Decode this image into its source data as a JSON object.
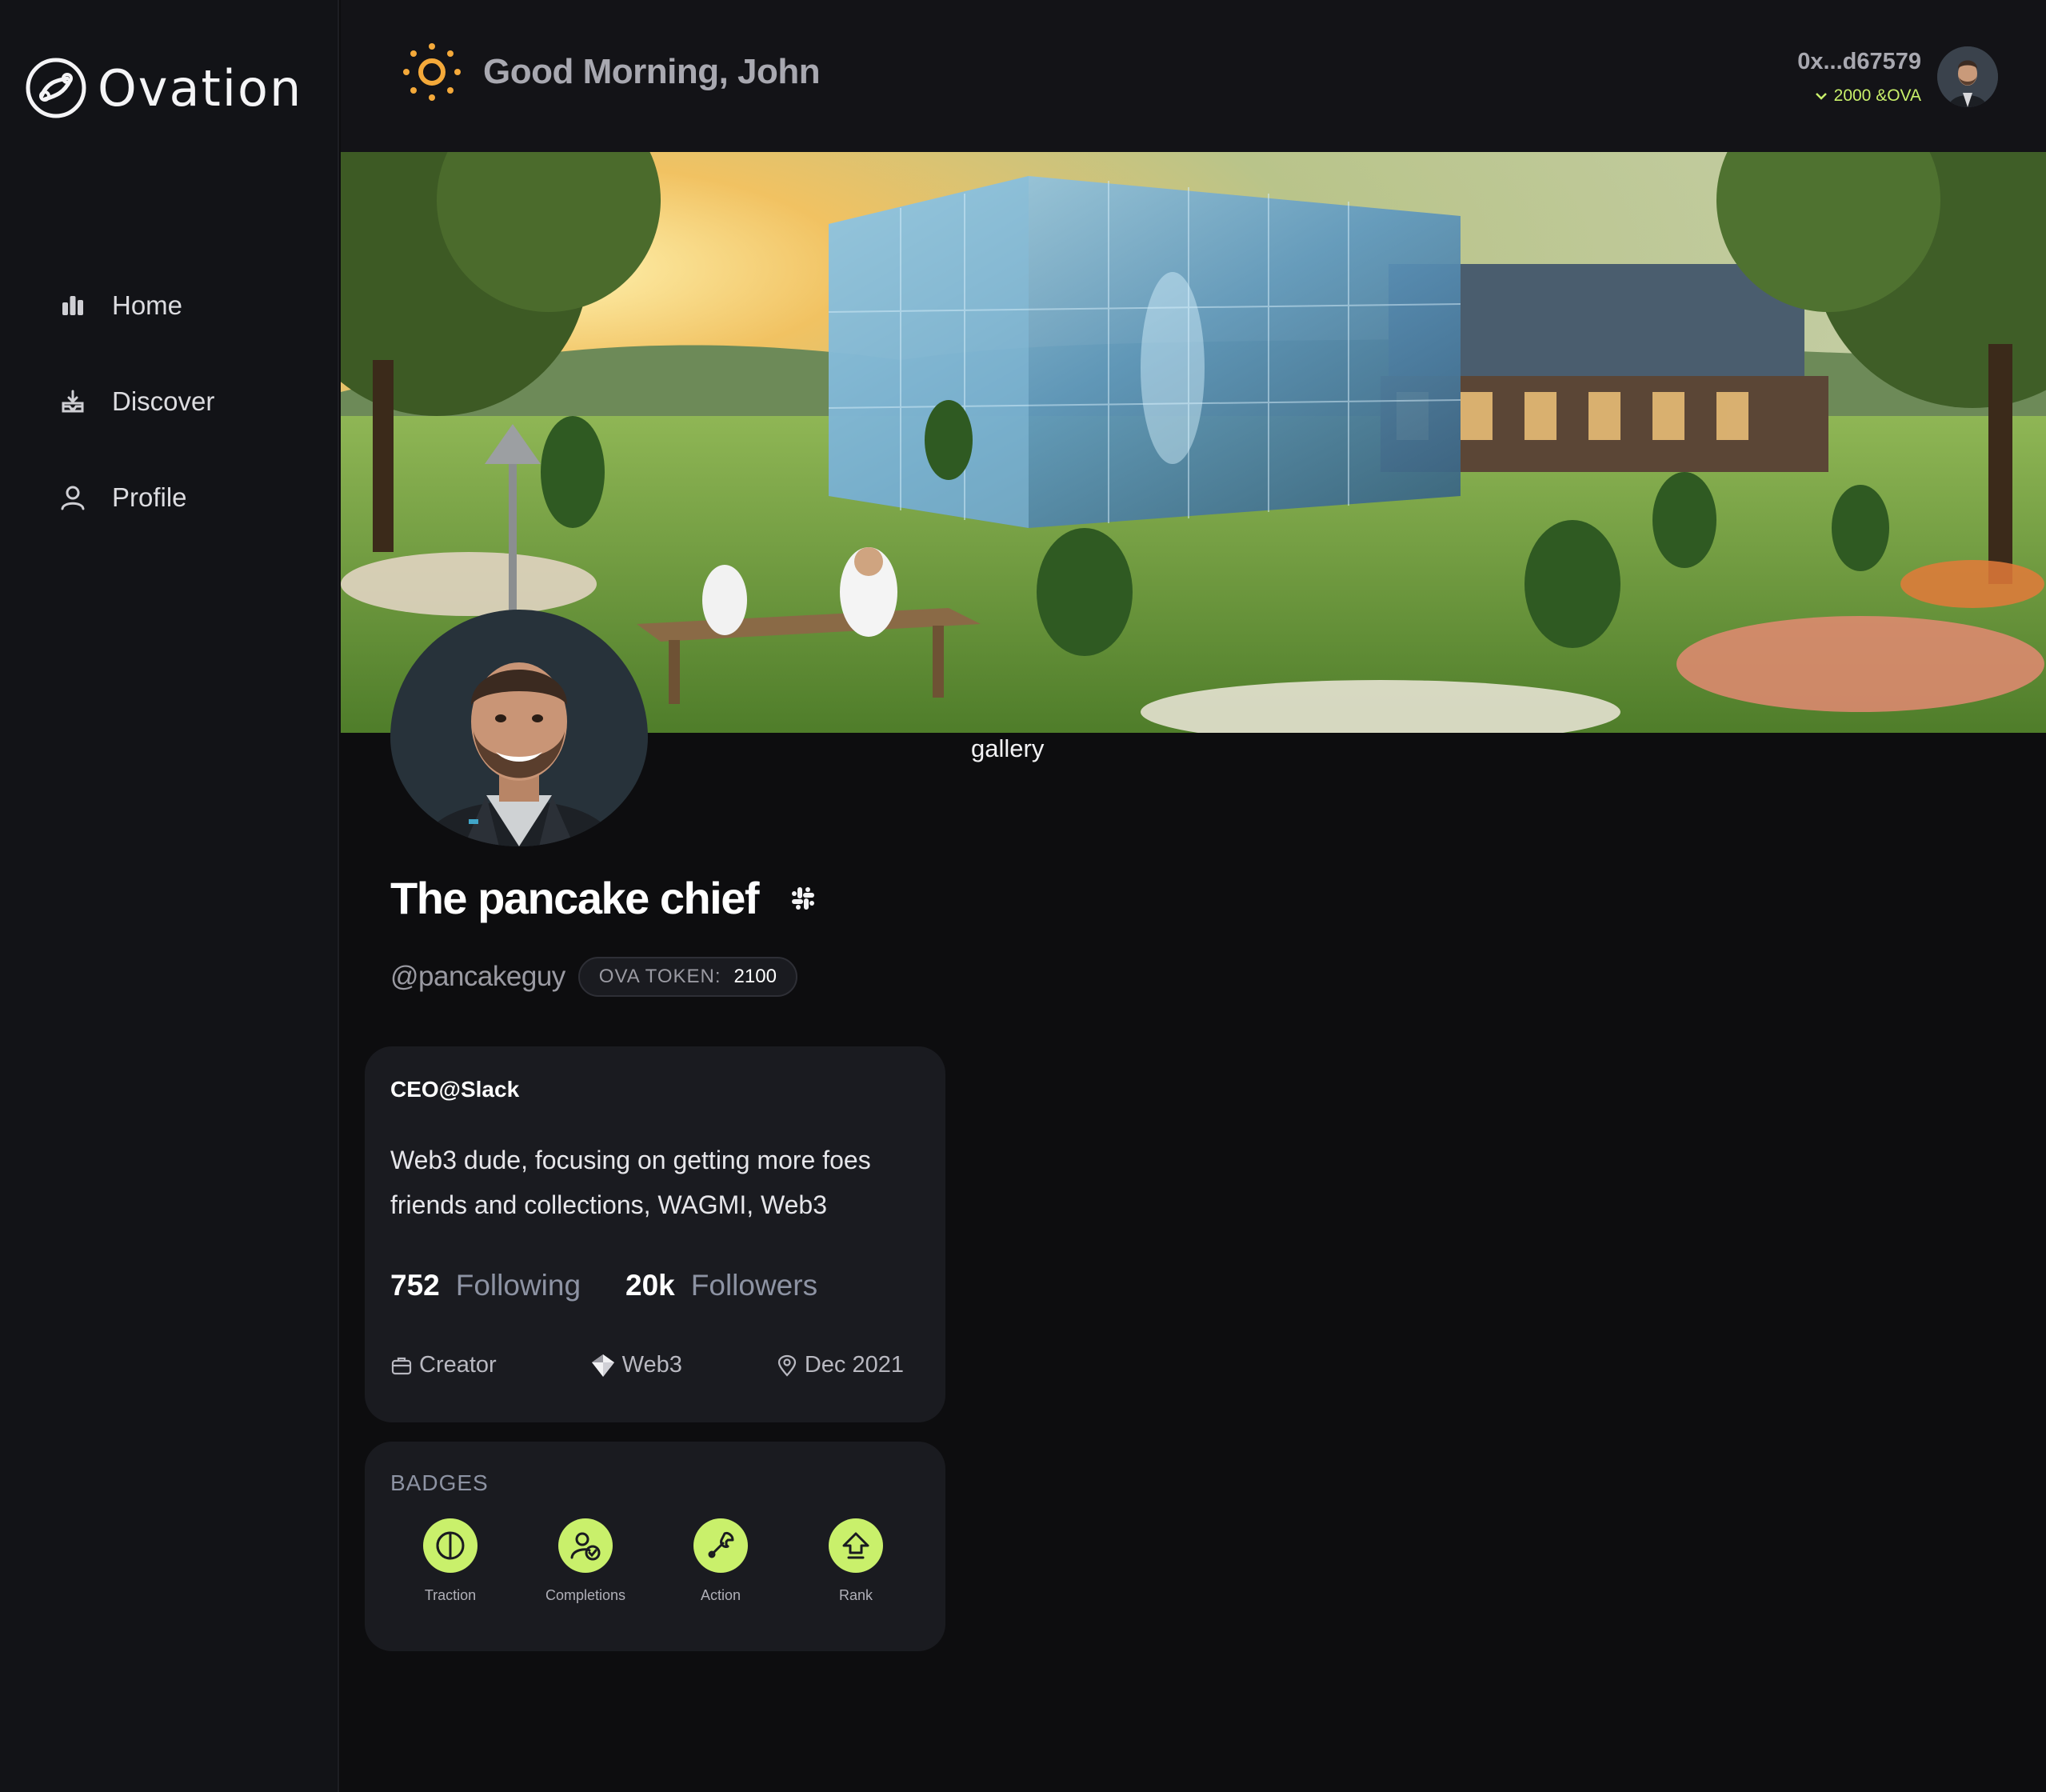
{
  "app": {
    "name": "Ovation"
  },
  "sidebar": {
    "items": [
      {
        "label": "Home",
        "icon": "bar-chart-icon"
      },
      {
        "label": "Discover",
        "icon": "discover-icon"
      },
      {
        "label": "Profile",
        "icon": "user-icon"
      }
    ]
  },
  "header": {
    "greeting": "Good Morning, John",
    "account": {
      "address": "0x...d67579",
      "balance": "2000 &OVA"
    }
  },
  "cover": {
    "label": "gallery"
  },
  "profile": {
    "name": "The pancake chief",
    "handle": "@pancakeguy",
    "token_label": "OVA TOKEN:",
    "token_value": "2100",
    "title": "CEO@Slack",
    "bio": "Web3 dude, focusing on getting more foes friends and collections, WAGMI, Web3",
    "following_count": "752",
    "following_label": "Following",
    "followers_count": "20k",
    "followers_label": "Followers",
    "role": "Creator",
    "interest": "Web3",
    "joined": "Dec 2021"
  },
  "badges": {
    "title": "BADGES",
    "items": [
      {
        "label": "Traction",
        "icon": "traction-icon"
      },
      {
        "label": "Completions",
        "icon": "completions-icon"
      },
      {
        "label": "Action",
        "icon": "wrench-icon"
      },
      {
        "label": "Rank",
        "icon": "rank-up-icon"
      }
    ]
  },
  "colors": {
    "accent": "#c9f06b",
    "background": "#0d0d0f",
    "card": "#1a1b20",
    "sun": "#f4a93a"
  }
}
